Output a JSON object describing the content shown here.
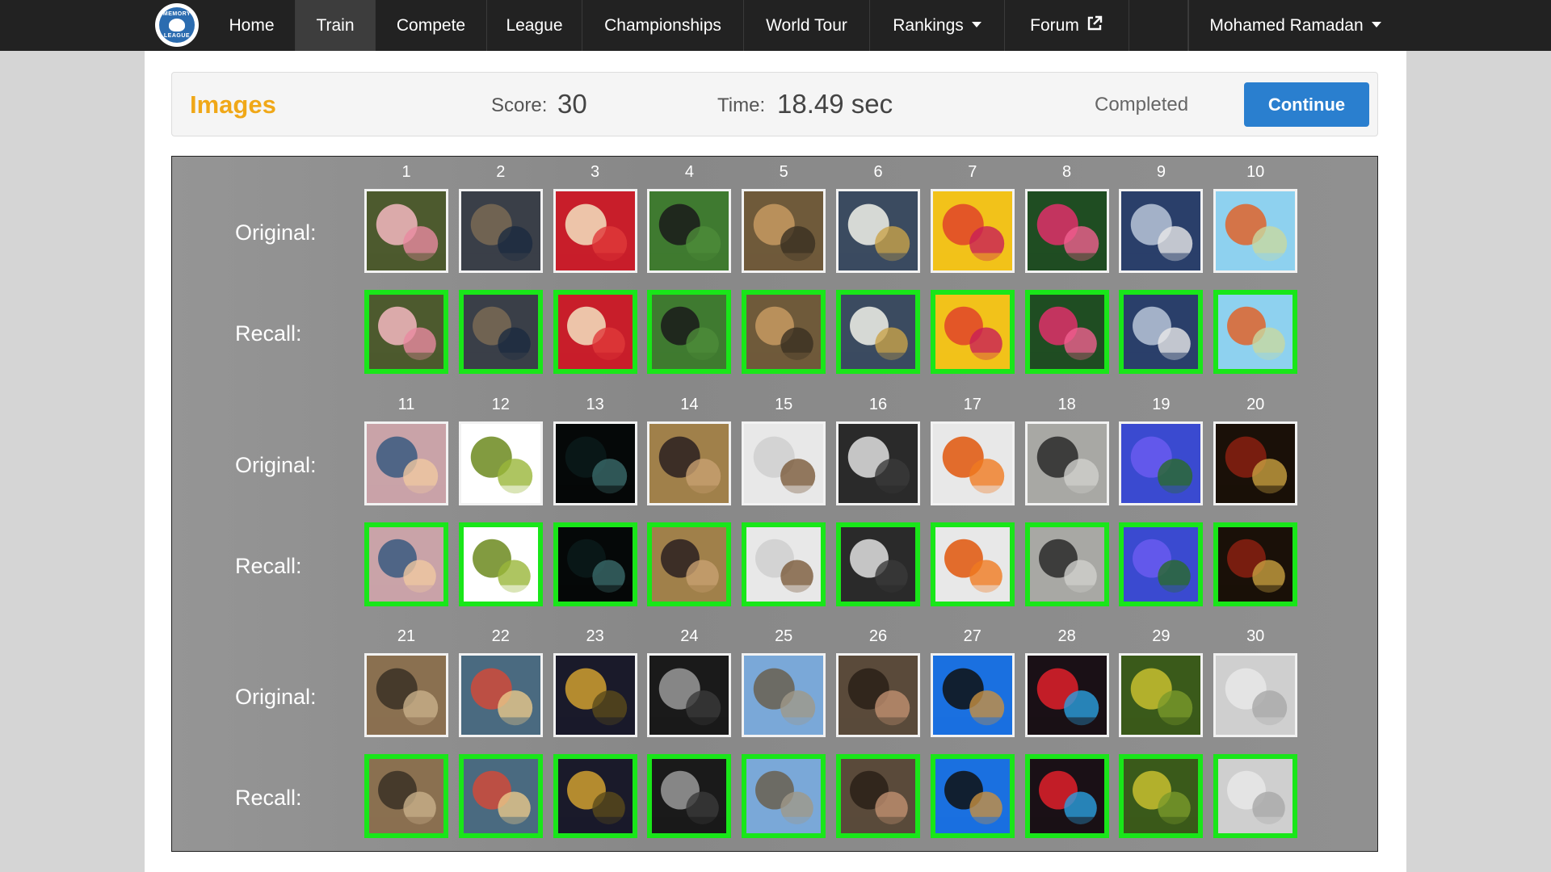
{
  "nav": {
    "logo_top": "MEMORY",
    "logo_bottom": "LEAGUE",
    "items": [
      {
        "id": "home",
        "label": "Home"
      },
      {
        "id": "train",
        "label": "Train"
      },
      {
        "id": "compete",
        "label": "Compete"
      },
      {
        "id": "league",
        "label": "League"
      },
      {
        "id": "championships",
        "label": "Championships"
      },
      {
        "id": "world-tour",
        "label": "World Tour"
      },
      {
        "id": "rankings",
        "label": "Rankings"
      },
      {
        "id": "forum",
        "label": "Forum"
      }
    ],
    "active": "Train",
    "user": "Mohamed Ramadan"
  },
  "status": {
    "title": "Images",
    "score_label": "Score:",
    "score": "30",
    "time_label": "Time:",
    "time": "18.49 sec",
    "state": "Completed",
    "continue_label": "Continue"
  },
  "board": {
    "original_label": "Original:",
    "recall_label": "Recall:",
    "colors": {
      "correct_border": "#19e619",
      "original_border": "#f2f2f2"
    },
    "blocks": [
      {
        "numbers": [
          "1",
          "2",
          "3",
          "4",
          "5",
          "6",
          "7",
          "8",
          "9",
          "10"
        ],
        "images": [
          "pink-roses",
          "busy-office-man",
          "cookies-candy",
          "black-turkey",
          "forest-dust-runner",
          "white-flowers-bee",
          "spools-of-thread",
          "pink-dahlia",
          "wind-turbines",
          "world-map-bookends"
        ],
        "correct": [
          true,
          true,
          true,
          true,
          true,
          true,
          true,
          true,
          true,
          true
        ]
      },
      {
        "numbers": [
          "11",
          "12",
          "13",
          "14",
          "15",
          "16",
          "17",
          "18",
          "19",
          "20"
        ],
        "images": [
          "sunset-beach",
          "palm-leaf",
          "dark-bubbles",
          "brown-rabbit",
          "glass-jar-cork",
          "chalkboard-question",
          "orange-pepper",
          "snake-on-sand",
          "purple-violets",
          "bar-bottles"
        ],
        "correct": [
          true,
          true,
          true,
          true,
          true,
          true,
          true,
          true,
          true,
          true
        ]
      },
      {
        "numbers": [
          "21",
          "22",
          "23",
          "24",
          "25",
          "26",
          "27",
          "28",
          "29",
          "30"
        ],
        "images": [
          "meerkats",
          "tart-slice",
          "night-city-bridge",
          "foggy-corridor",
          "great-wall",
          "coffee-cup-wood",
          "yoga-pose-rock",
          "bokeh-lights",
          "green-plant",
          "snowy-field"
        ],
        "correct": [
          true,
          true,
          true,
          true,
          true,
          true,
          true,
          true,
          true,
          true
        ]
      }
    ]
  }
}
